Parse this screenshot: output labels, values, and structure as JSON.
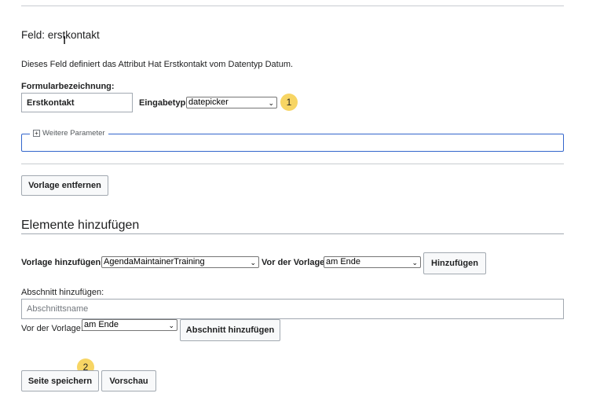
{
  "field": {
    "title": "Feld: erstkontakt",
    "description": "Dieses Feld definiert das Attribut Hat Erstkontakt vom Datentyp Datum.",
    "form_label_caption": "Formularbezeichnung:",
    "form_label_value": "Erstkontakt",
    "input_type_caption": "Eingabetyp:",
    "input_type_value": "datepicker",
    "more_params_legend": "Weitere Parameter",
    "remove_template_button": "Vorlage entfernen"
  },
  "add_elements": {
    "heading": "Elemente hinzufügen",
    "template_caption": "Vorlage hinzufügen:",
    "template_value": "AgendaMaintainerTraining",
    "before_template_caption": "Vor der Vorlage:",
    "before_template_value": "am Ende",
    "add_button": "Hinzufügen",
    "section_caption": "Abschnitt hinzufügen:",
    "section_placeholder": "Abschnittsname",
    "section_before_caption": "Vor der Vorlage:",
    "section_before_value": "am Ende",
    "add_section_button": "Abschnitt hinzufügen"
  },
  "footer": {
    "save_button": "Seite speichern",
    "preview_button": "Vorschau"
  },
  "badges": {
    "one": "1",
    "two": "2"
  },
  "icons": {
    "expand": "plus-box-icon",
    "dropdown": "chevron-down-icon"
  }
}
